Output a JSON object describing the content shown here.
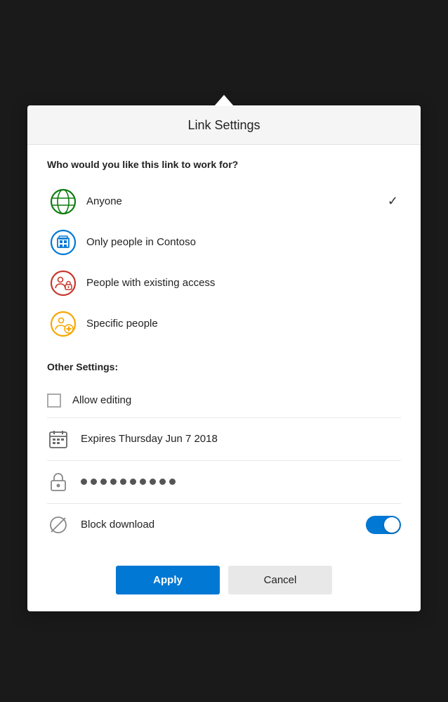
{
  "dialog": {
    "title": "Link Settings",
    "question": "Who would you like this link to work for?",
    "link_options": [
      {
        "id": "anyone",
        "label": "Anyone",
        "selected": true,
        "icon": "globe"
      },
      {
        "id": "contoso",
        "label": "Only people in Contoso",
        "selected": false,
        "icon": "building"
      },
      {
        "id": "existing",
        "label": "People with existing access",
        "selected": false,
        "icon": "group-lock"
      },
      {
        "id": "specific",
        "label": "Specific people",
        "selected": false,
        "icon": "group-add"
      }
    ],
    "other_settings_label": "Other Settings:",
    "settings": [
      {
        "id": "allow-editing",
        "label": "Allow editing",
        "type": "checkbox",
        "checked": false
      },
      {
        "id": "expires",
        "label": "Expires Thursday Jun 7 2018",
        "type": "date",
        "icon": "calendar"
      },
      {
        "id": "password",
        "label": "password",
        "type": "password",
        "icon": "lock"
      },
      {
        "id": "block-download",
        "label": "Block download",
        "type": "toggle",
        "enabled": true,
        "icon": "no-download"
      }
    ],
    "footer": {
      "apply_label": "Apply",
      "cancel_label": "Cancel"
    }
  }
}
